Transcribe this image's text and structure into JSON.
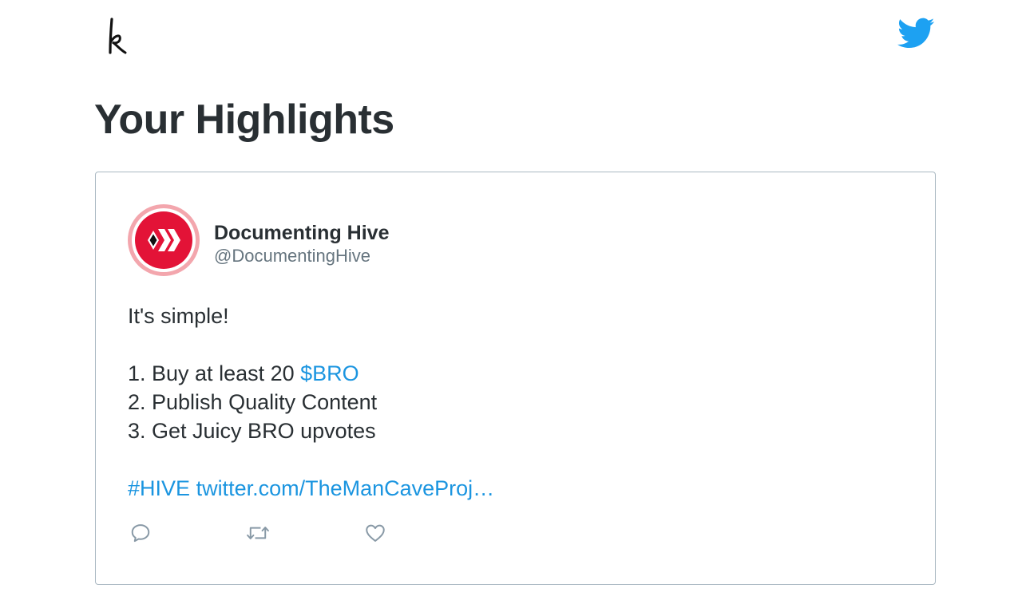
{
  "header": {
    "logo_icon": "k-script-logo",
    "social_icon": "twitter-bird-icon",
    "social_color": "#1da1f2"
  },
  "page": {
    "title": "Your Highlights"
  },
  "tweet": {
    "author_name": "Documenting Hive",
    "author_handle": "@DocumentingHive",
    "avatar_icon": "hive-logo-icon",
    "lines": {
      "l1": "It's simple!",
      "l2_prefix": "1. Buy at least 20 ",
      "l2_link": "$BRO",
      "l3": "2. Publish Quality Content",
      "l4": "3. Get Juicy BRO upvotes",
      "hashtag": "#HIVE",
      "url": "twitter.com/TheManCaveProj…"
    },
    "actions": [
      "reply-icon",
      "retweet-icon",
      "like-icon"
    ],
    "link_color": "#1b95e0"
  }
}
